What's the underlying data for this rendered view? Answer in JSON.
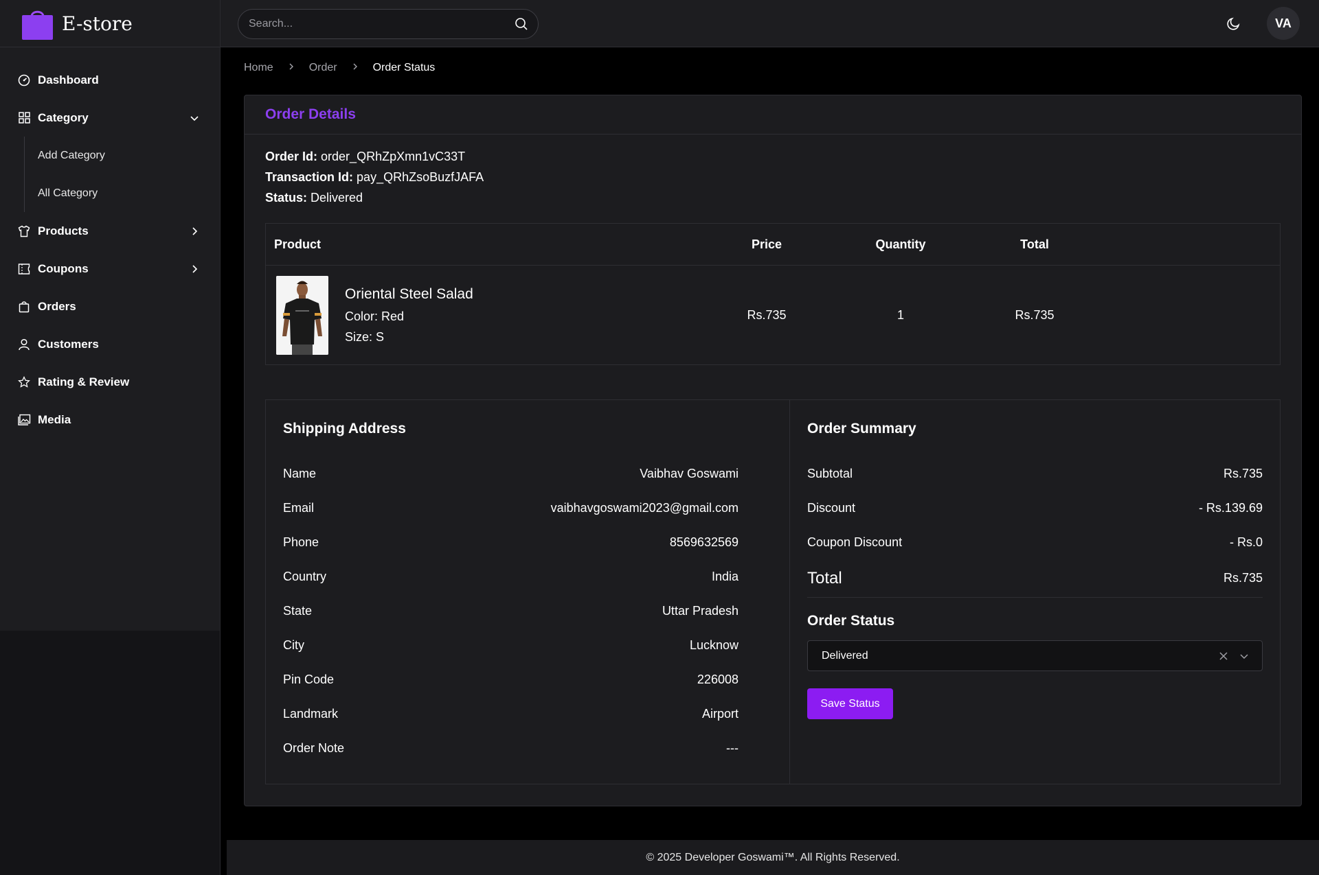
{
  "app": {
    "brand_name": "E-store",
    "accent": "#8c1cf2",
    "title_accent": "#8c3ff0"
  },
  "sidebar": {
    "items": [
      {
        "label": "Dashboard",
        "icon": "dashboard-icon"
      },
      {
        "label": "Category",
        "icon": "grid-icon",
        "expanded": true,
        "children": [
          "Add Category",
          "All Category"
        ]
      },
      {
        "label": "Products",
        "icon": "shirt-icon"
      },
      {
        "label": "Coupons",
        "icon": "ticket-icon"
      },
      {
        "label": "Orders",
        "icon": "bag-icon"
      },
      {
        "label": "Customers",
        "icon": "user-icon"
      },
      {
        "label": "Rating & Review",
        "icon": "star-icon"
      },
      {
        "label": "Media",
        "icon": "image-icon"
      }
    ]
  },
  "topbar": {
    "search_placeholder": "Search...",
    "avatar_initials": "VA"
  },
  "breadcrumb": {
    "home": "Home",
    "order": "Order",
    "current": "Order Status"
  },
  "order": {
    "card_title": "Order Details",
    "order_id_label": "Order Id:",
    "order_id": "order_QRhZpXmn1vC33T",
    "transaction_id_label": "Transaction Id:",
    "transaction_id": "pay_QRhZsoBuzfJAFA",
    "status_label": "Status:",
    "status": "Delivered"
  },
  "product_table": {
    "headers": {
      "product": "Product",
      "price": "Price",
      "quantity": "Quantity",
      "total": "Total"
    },
    "rows": [
      {
        "name": "Oriental Steel Salad",
        "color": "Color: Red",
        "size": "Size: S",
        "price": "Rs.735",
        "quantity": "1",
        "total": "Rs.735"
      }
    ]
  },
  "shipping": {
    "title": "Shipping Address",
    "fields": [
      {
        "label": "Name",
        "value": "Vaibhav Goswami"
      },
      {
        "label": "Email",
        "value": "vaibhavgoswami2023@gmail.com"
      },
      {
        "label": "Phone",
        "value": "8569632569"
      },
      {
        "label": "Country",
        "value": "India"
      },
      {
        "label": "State",
        "value": "Uttar Pradesh"
      },
      {
        "label": "City",
        "value": "Lucknow"
      },
      {
        "label": "Pin Code",
        "value": "226008"
      },
      {
        "label": "Landmark",
        "value": "Airport"
      },
      {
        "label": "Order Note",
        "value": "---"
      }
    ]
  },
  "summary": {
    "title": "Order Summary",
    "subtotal_label": "Subtotal",
    "subtotal": "Rs.735",
    "discount_label": "Discount",
    "discount": "- Rs.139.69",
    "coupon_label": "Coupon Discount",
    "coupon": "- Rs.0",
    "total_label": "Total",
    "total": "Rs.735",
    "status_title": "Order Status",
    "status_value": "Delivered",
    "save_label": "Save Status"
  },
  "footer": {
    "text": "© 2025 Developer Goswami™. All Rights Reserved."
  }
}
